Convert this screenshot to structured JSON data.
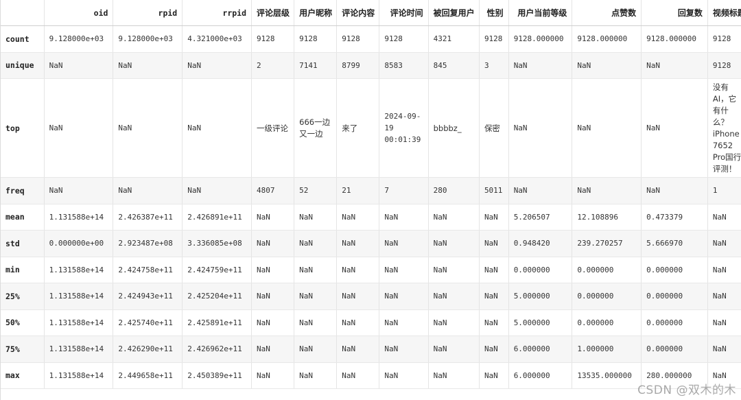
{
  "columns": [
    "",
    "oid",
    "rpid",
    "rrpid",
    "评论层级",
    "用户昵称",
    "评论内容",
    "评论时间",
    "被回复用户",
    "性别",
    "用户当前等级",
    "点赞数",
    "回复数",
    "视频标题"
  ],
  "rows": [
    {
      "label": "count",
      "cells": [
        "9.128000e+03",
        "9.128000e+03",
        "4.321000e+03",
        "9128",
        "9128",
        "9128",
        "9128",
        "4321",
        "9128",
        "9128.000000",
        "9128.000000",
        "9128.000000",
        "9128"
      ]
    },
    {
      "label": "unique",
      "cells": [
        "NaN",
        "NaN",
        "NaN",
        "2",
        "7141",
        "8799",
        "8583",
        "845",
        "3",
        "NaN",
        "NaN",
        "NaN",
        "9128"
      ]
    },
    {
      "label": "top",
      "cells": [
        "NaN",
        "NaN",
        "NaN",
        "一级评论",
        "666一边又一边",
        "来了",
        "2024-09-19 00:01:39",
        "bbbbz_",
        "保密",
        "NaN",
        "NaN",
        "NaN",
        "没有AI，它有什么？iPhone 7652 Pro国行评测！"
      ]
    },
    {
      "label": "freq",
      "cells": [
        "NaN",
        "NaN",
        "NaN",
        "4807",
        "52",
        "21",
        "7",
        "280",
        "5011",
        "NaN",
        "NaN",
        "NaN",
        "1"
      ]
    },
    {
      "label": "mean",
      "cells": [
        "1.131588e+14",
        "2.426387e+11",
        "2.426891e+11",
        "NaN",
        "NaN",
        "NaN",
        "NaN",
        "NaN",
        "NaN",
        "5.206507",
        "12.108896",
        "0.473379",
        "NaN"
      ]
    },
    {
      "label": "std",
      "cells": [
        "0.000000e+00",
        "2.923487e+08",
        "3.336085e+08",
        "NaN",
        "NaN",
        "NaN",
        "NaN",
        "NaN",
        "NaN",
        "0.948420",
        "239.270257",
        "5.666970",
        "NaN"
      ]
    },
    {
      "label": "min",
      "cells": [
        "1.131588e+14",
        "2.424758e+11",
        "2.424759e+11",
        "NaN",
        "NaN",
        "NaN",
        "NaN",
        "NaN",
        "NaN",
        "0.000000",
        "0.000000",
        "0.000000",
        "NaN"
      ]
    },
    {
      "label": "25%",
      "cells": [
        "1.131588e+14",
        "2.424943e+11",
        "2.425204e+11",
        "NaN",
        "NaN",
        "NaN",
        "NaN",
        "NaN",
        "NaN",
        "5.000000",
        "0.000000",
        "0.000000",
        "NaN"
      ]
    },
    {
      "label": "50%",
      "cells": [
        "1.131588e+14",
        "2.425740e+11",
        "2.425891e+11",
        "NaN",
        "NaN",
        "NaN",
        "NaN",
        "NaN",
        "NaN",
        "5.000000",
        "0.000000",
        "0.000000",
        "NaN"
      ]
    },
    {
      "label": "75%",
      "cells": [
        "1.131588e+14",
        "2.426290e+11",
        "2.426962e+11",
        "NaN",
        "NaN",
        "NaN",
        "NaN",
        "NaN",
        "NaN",
        "6.000000",
        "1.000000",
        "0.000000",
        "NaN"
      ]
    },
    {
      "label": "max",
      "cells": [
        "1.131588e+14",
        "2.449658e+11",
        "2.450389e+11",
        "NaN",
        "NaN",
        "NaN",
        "NaN",
        "NaN",
        "NaN",
        "6.000000",
        "13535.000000",
        "280.000000",
        "NaN"
      ]
    }
  ],
  "watermark": "CSDN @双木的木"
}
